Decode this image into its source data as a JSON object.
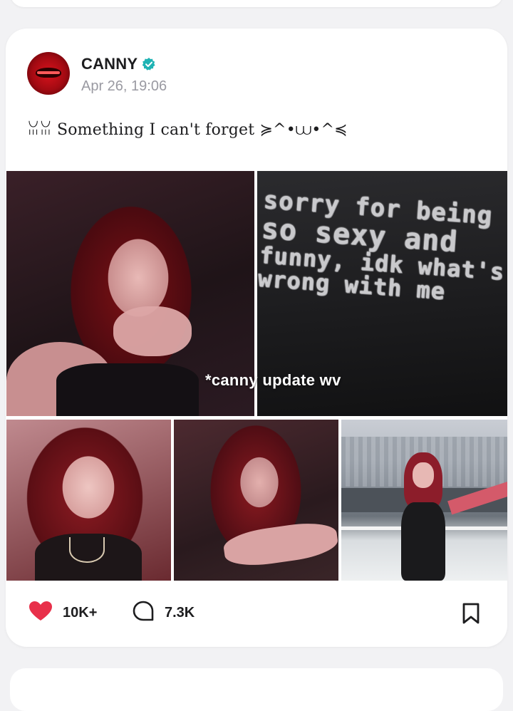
{
  "post": {
    "author": {
      "name": "CANNY",
      "verified": true,
      "verified_color": "#1fb3b4"
    },
    "timestamp": "Apr 26, 19:06",
    "caption": "ꈍꈍ Something I can't forget ≽^•⩊•^≼",
    "photos": [
      {
        "shirt_lines": [
          "sorry for being",
          "so sexy and",
          "funny, idk what's",
          "wrong with me"
        ]
      }
    ],
    "overlay_caption": "*canny update wv",
    "likes": "10K+",
    "comments": "7.3K",
    "icons": {
      "like": "heart-icon",
      "like_color": "#e8304a",
      "comment": "comment-bubble-icon",
      "save": "bookmark-icon"
    }
  }
}
